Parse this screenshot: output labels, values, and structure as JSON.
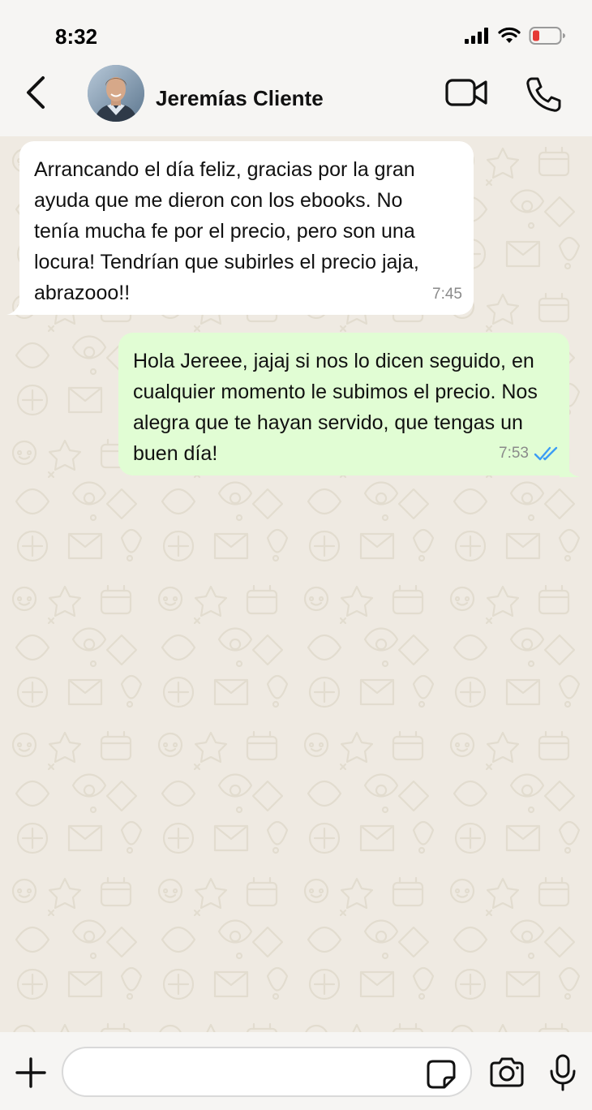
{
  "status_bar": {
    "time": "8:32",
    "signal_icon": "cellular-signal-icon",
    "wifi_icon": "wifi-icon",
    "battery_icon": "battery-low-icon",
    "battery_color": "#e53935"
  },
  "header": {
    "back_icon": "chevron-left-icon",
    "contact_name": "Jeremías Cliente",
    "video_icon": "video-camera-icon",
    "call_icon": "phone-icon"
  },
  "messages": [
    {
      "direction": "incoming",
      "text": "Arrancando el día feliz, gracias por la gran ayuda que me dieron con los ebooks. No tenía mucha fe por el precio, pero son una locura! Tendrían que subirles el precio jaja, abrazooo!!",
      "time": "7:45"
    },
    {
      "direction": "outgoing",
      "text": "Hola Jereee, jajaj si nos lo dicen seguido, en cualquier momento le subimos el precio. Nos alegra que te hayan servido, que tengas un buen día!",
      "time": "7:53",
      "status_icon": "double-check-icon",
      "status_color": "#3b9cf5"
    }
  ],
  "colors": {
    "chat_background": "#efeae2",
    "incoming_bubble": "#ffffff",
    "outgoing_bubble": "#e1fdd4"
  },
  "input_bar": {
    "plus_icon": "plus-icon",
    "input_value": "",
    "input_placeholder": "",
    "sticker_icon": "sticker-icon",
    "camera_icon": "camera-icon",
    "mic_icon": "microphone-icon"
  }
}
